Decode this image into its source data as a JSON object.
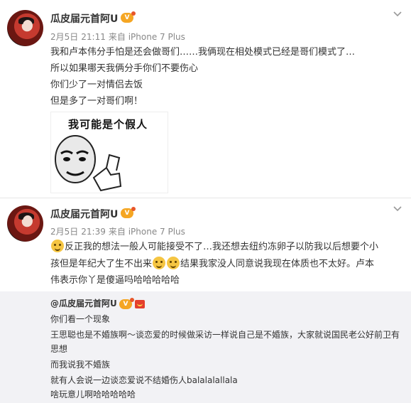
{
  "post1": {
    "username": "瓜皮届元首阿U",
    "vip_badge": "V",
    "date": "2月5日",
    "time": "21:11",
    "source": "来自 iPhone 7 Plus",
    "lines": [
      "我和卢本伟分手怕是还会做哥们……我俩现在相处模式已经是哥们模式了…",
      "所以如果哪天我俩分手你们不要伤心",
      "你们少了一对情侣去饭",
      "但是多了一对哥们啊！"
    ],
    "image_caption": "我可能是个假人"
  },
  "post2": {
    "username": "瓜皮届元首阿U",
    "vip_badge": "V",
    "date": "2月5日",
    "time": "21:39",
    "source": "来自 iPhone 7 Plus",
    "line1": "反正我的想法一般人可能接受不了…我还想去纽约冻卵子以防我以后想要个小",
    "line2_a": "孩但是年纪大了生不出来",
    "line2_b": "结果我家没人同意说我现在体质也不太好。卢本",
    "line3": "伟表示你丫是傻逼吗哈哈哈哈哈"
  },
  "repost": {
    "username": "@瓜皮届元首阿U",
    "lines": [
      "你们看一个现象",
      "王思聪也是不婚族啊～谈恋爱的时候做采访一样说自己是不婚族，大家就说国民老公好前卫有",
      "思想",
      "而我说我不婚族",
      "就有人会说一边谈恋爱说不结婚伤人balalalallala",
      "啥玩意儿啊哈哈哈哈哈"
    ]
  },
  "icons": {
    "avatar": "avatar",
    "more": "chevron-down-icon",
    "vip": "vip-badge-icon",
    "emoji": "smile-emoji-icon",
    "flag": "red-flag-icon"
  }
}
